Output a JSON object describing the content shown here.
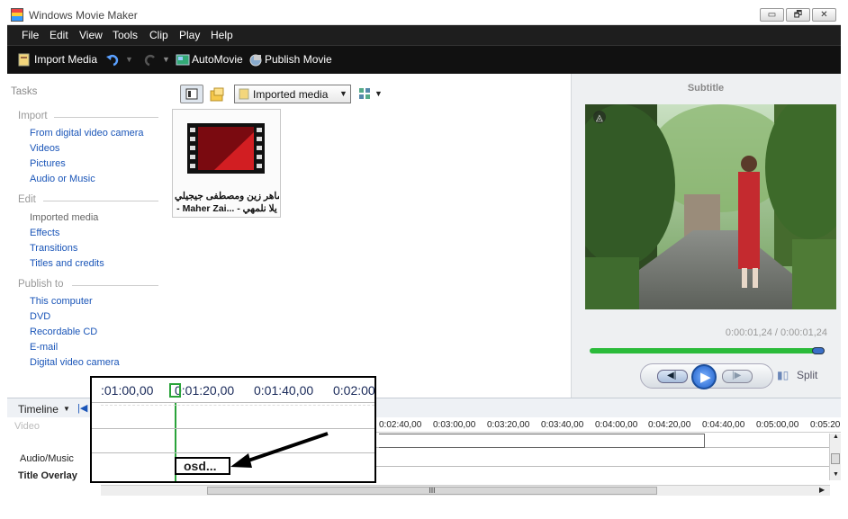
{
  "window": {
    "title": "Windows Movie Maker",
    "controls": [
      "▭",
      "🗗",
      "✕"
    ]
  },
  "menu": [
    "File",
    "Edit",
    "View",
    "Tools",
    "Clip",
    "Play",
    "Help"
  ],
  "toolbar": {
    "import": "Import Media",
    "automovie": "AutoMovie",
    "publish": "Publish Movie"
  },
  "tasks": {
    "heading": "Tasks",
    "sections": [
      {
        "title": "Import",
        "items": [
          "From digital video camera",
          "Videos",
          "Pictures",
          "Audio or Music"
        ]
      },
      {
        "title": "Edit",
        "items": [
          "Imported media",
          "Effects",
          "Transitions",
          "Titles and credits"
        ]
      },
      {
        "title": "Publish to",
        "items": [
          "This computer",
          "DVD",
          "Recordable CD",
          "E-mail",
          "Digital video camera"
        ]
      }
    ]
  },
  "media": {
    "dropdown": "Imported media",
    "clip_line1": "ماهر زين ومصطفى جيجيلي",
    "clip_line2": "- Maher Zai... - يلا نلمهي"
  },
  "preview": {
    "title": "Subtitle",
    "time": "0:00:01,24 / 0:00:01,24",
    "split": "Split",
    "progress": 0.98
  },
  "timeline": {
    "label": "Timeline",
    "ticks": [
      "0:02:40,00",
      "0:03:00,00",
      "0:03:20,00",
      "0:03:40,00",
      "0:04:00,00",
      "0:04:20,00",
      "0:04:40,00",
      "0:05:00,00",
      "0:05:20"
    ],
    "tracks": [
      "Video",
      "Audio/Music",
      "Title Overlay"
    ],
    "scroll_mark": "III"
  },
  "zoom": {
    "ticks": [
      ":01:00,00",
      "0:01:20,00",
      "0:01:40,00",
      "0:02:00"
    ],
    "clip": "osd..."
  }
}
